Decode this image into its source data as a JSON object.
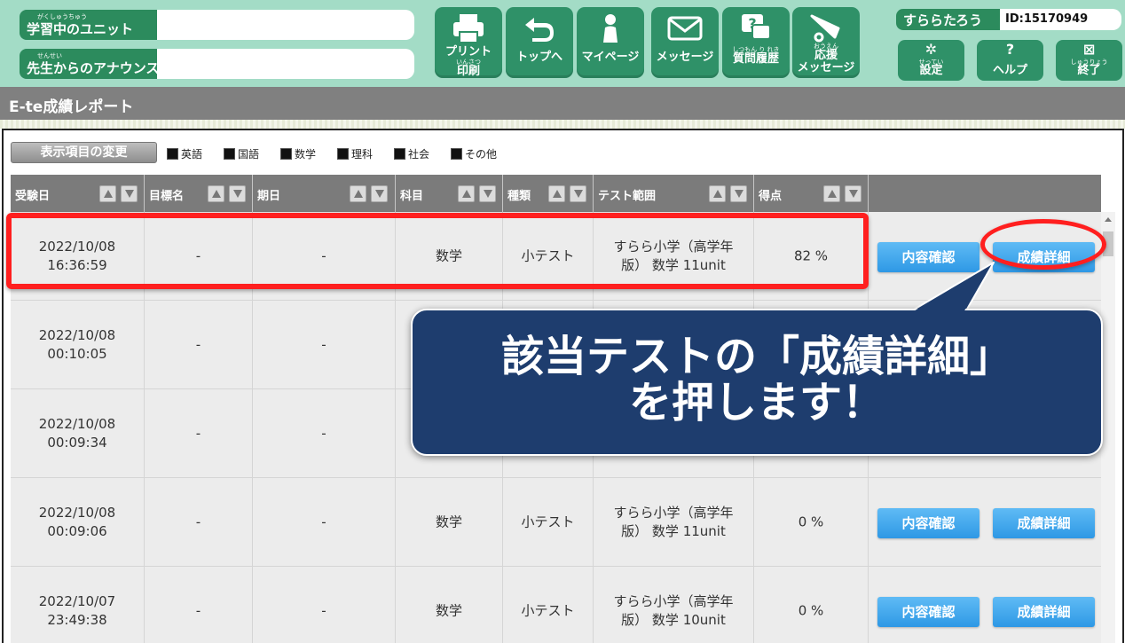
{
  "header": {
    "unit_label": "学習中のユニット",
    "unit_ruby": "がくしゅうちゅう",
    "unit_value": "",
    "announce_label": "先生からのアナウンス",
    "announce_ruby": "せんせい",
    "announce_value": "",
    "nav": [
      {
        "icon": "printer-icon",
        "label": "プリント",
        "ruby": "いんさつ",
        "label2": "印刷"
      },
      {
        "icon": "return-arrow-icon",
        "label": "トップへ"
      },
      {
        "icon": "person-icon",
        "label": "マイページ"
      },
      {
        "icon": "envelope-icon",
        "label": "メッセージ"
      },
      {
        "icon": "question-bubble-icon",
        "ruby": "しつもん り れき",
        "label": "質問履歴"
      },
      {
        "icon": "megaphone-icon",
        "ruby": "おうえん",
        "label": "応援",
        "label2": "メッセージ"
      }
    ],
    "user_name": "すららたろう",
    "user_id": "ID:15170949",
    "system": [
      {
        "icon": "gear-icon",
        "ruby": "せってい",
        "label": "設定"
      },
      {
        "icon": "help-icon",
        "label": "ヘルプ"
      },
      {
        "icon": "close-icon",
        "ruby": "しゅうりょう",
        "label": "終了"
      }
    ]
  },
  "page_title": "E-te成績レポート",
  "toolbar": {
    "change_button": "表示項目の変更",
    "subjects": [
      "英語",
      "国語",
      "数学",
      "理科",
      "社会",
      "その他"
    ]
  },
  "table": {
    "columns": [
      "受験日",
      "目標名",
      "期日",
      "科目",
      "種類",
      "テスト範囲",
      "得点"
    ],
    "rows": [
      {
        "date": "2022/10/08",
        "time": "16:36:59",
        "goal": "-",
        "due": "-",
        "subject": "数学",
        "kind": "小テスト",
        "range1": "すらら小学（高学年",
        "range2": "版） 数学 11unit",
        "score": "82 %"
      },
      {
        "date": "2022/10/08",
        "time": "00:10:05",
        "goal": "-",
        "due": "-",
        "subject": "",
        "kind": "",
        "range1": "",
        "range2": "",
        "score": ""
      },
      {
        "date": "2022/10/08",
        "time": "00:09:34",
        "goal": "-",
        "due": "-",
        "subject": "",
        "kind": "",
        "range1": "",
        "range2": "",
        "score": ""
      },
      {
        "date": "2022/10/08",
        "time": "00:09:06",
        "goal": "-",
        "due": "-",
        "subject": "数学",
        "kind": "小テスト",
        "range1": "すらら小学（高学年",
        "range2": "版） 数学 11unit",
        "score": "0 %"
      },
      {
        "date": "2022/10/07",
        "time": "23:49:38",
        "goal": "-",
        "due": "-",
        "subject": "数学",
        "kind": "小テスト",
        "range1": "すらら小学（高学年",
        "range2": "版） 数学 10unit",
        "score": "0 %"
      }
    ],
    "content_button": "内容確認",
    "detail_button": "成績詳細"
  },
  "callout": {
    "line1": "該当テストの「成績詳細」",
    "line2": "を押します！"
  },
  "colors": {
    "header_bg": "#a3dcc6",
    "nav_green": "#2f9168",
    "label_green": "#2c8b5d",
    "title_gray": "#808080",
    "action_blue": "#2e98e5",
    "highlight_red": "#ff1f1f",
    "callout_navy": "#1e3d6e"
  }
}
